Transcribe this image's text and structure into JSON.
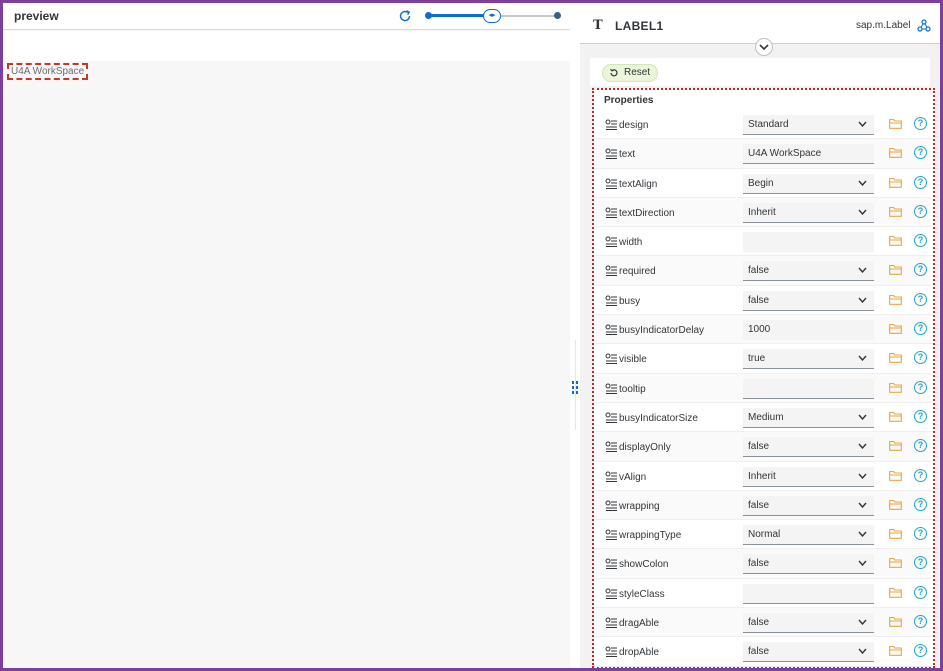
{
  "preview": {
    "title": "preview",
    "workspace_label": "U4A WorkSpace"
  },
  "control": {
    "name": "LABEL1",
    "class": "sap.m.Label",
    "reset_label": "Reset"
  },
  "properties": {
    "title": "Properties",
    "rows": [
      {
        "name": "design",
        "value": "Standard",
        "kind": "select"
      },
      {
        "name": "text",
        "value": "U4A WorkSpace",
        "kind": "input"
      },
      {
        "name": "textAlign",
        "value": "Begin",
        "kind": "select"
      },
      {
        "name": "textDirection",
        "value": "Inherit",
        "kind": "select"
      },
      {
        "name": "width",
        "value": "",
        "kind": "input-empty"
      },
      {
        "name": "required",
        "value": "false",
        "kind": "select"
      },
      {
        "name": "busy",
        "value": "false",
        "kind": "select"
      },
      {
        "name": "busyIndicatorDelay",
        "value": "1000",
        "kind": "input-empty"
      },
      {
        "name": "visible",
        "value": "true",
        "kind": "select"
      },
      {
        "name": "tooltip",
        "value": "",
        "kind": "input"
      },
      {
        "name": "busyIndicatorSize",
        "value": "Medium",
        "kind": "select"
      },
      {
        "name": "displayOnly",
        "value": "false",
        "kind": "select"
      },
      {
        "name": "vAlign",
        "value": "Inherit",
        "kind": "select"
      },
      {
        "name": "wrapping",
        "value": "false",
        "kind": "select"
      },
      {
        "name": "wrappingType",
        "value": "Normal",
        "kind": "select"
      },
      {
        "name": "showColon",
        "value": "false",
        "kind": "select"
      },
      {
        "name": "styleClass",
        "value": "",
        "kind": "input"
      },
      {
        "name": "dragAble",
        "value": "false",
        "kind": "select"
      },
      {
        "name": "dropAble",
        "value": "false",
        "kind": "select"
      }
    ]
  },
  "colors": {
    "frame": "#7b3f9e",
    "accent": "#0a6ed1",
    "highlight_border": "#d01f1f",
    "help_icon": "#1fa6c9",
    "folder_icon": "#e9a53a",
    "reset_bg": "#eaf5d9"
  },
  "icons": {
    "refresh": "refresh-icon",
    "label_type": "label-type-icon",
    "network": "network-icon",
    "collapse": "chevron-down-icon",
    "reset": "reset-icon",
    "property": "property-icon",
    "binding": "folder-icon",
    "help": "help-icon"
  }
}
